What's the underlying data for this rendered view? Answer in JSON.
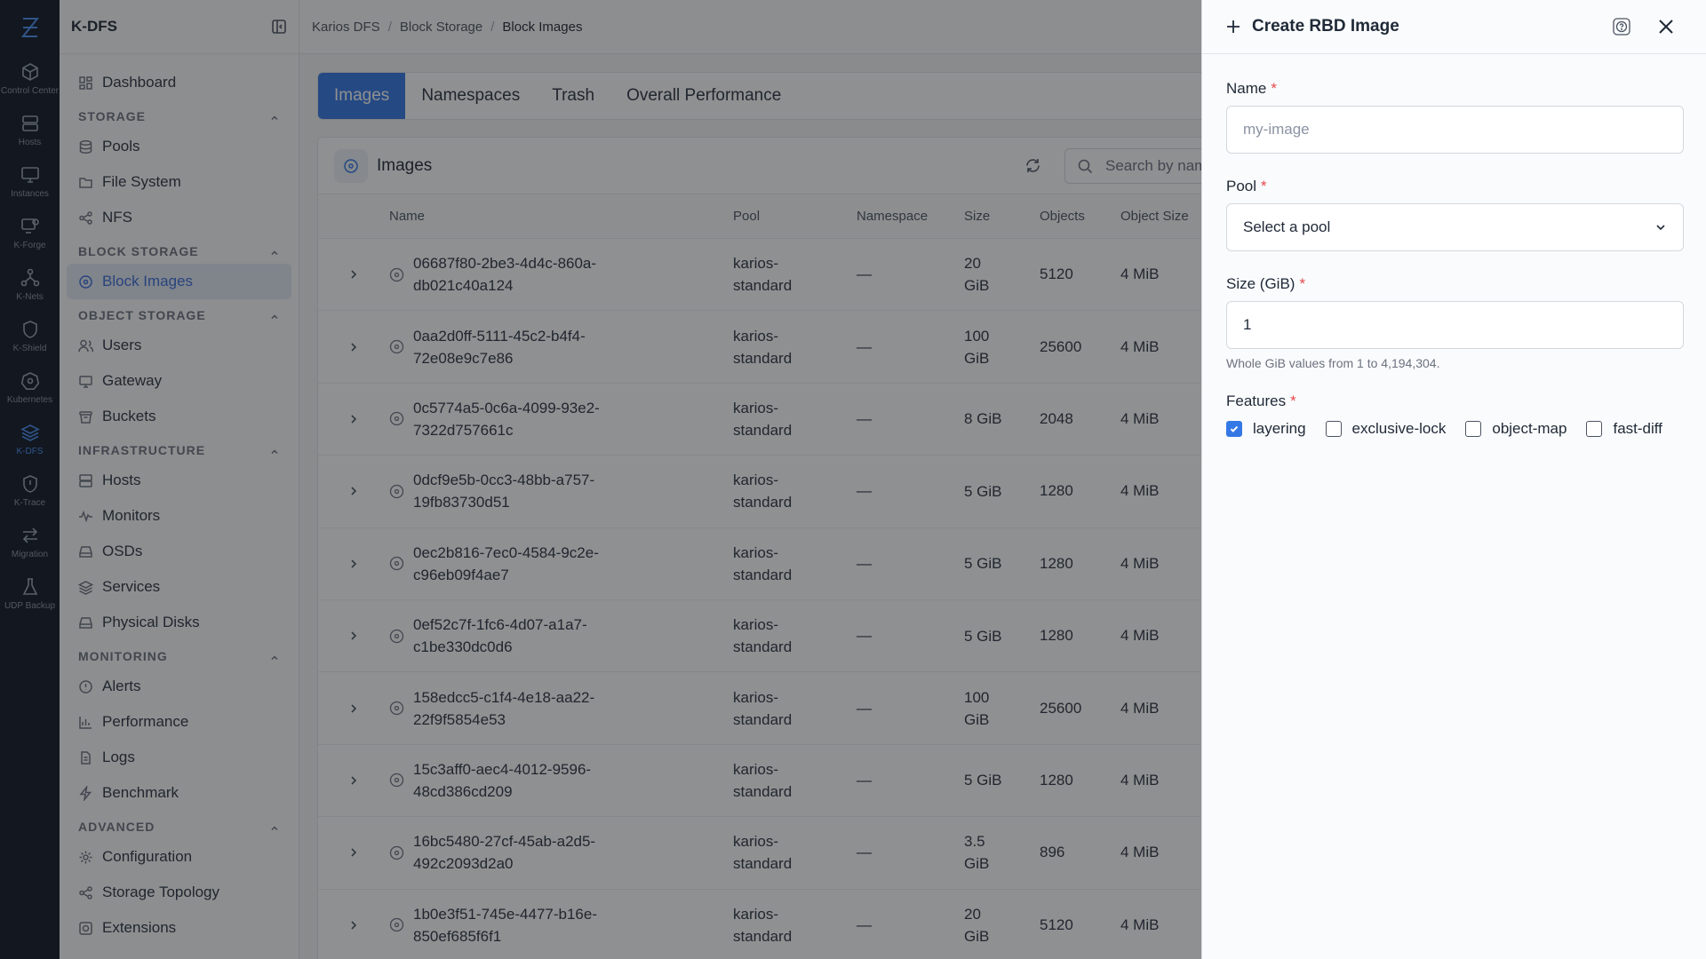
{
  "rail": [
    {
      "label": "Control Center",
      "icon": "cube-icon"
    },
    {
      "label": "Hosts",
      "icon": "server-icon"
    },
    {
      "label": "Instances",
      "icon": "monitor-icon"
    },
    {
      "label": "K-Forge",
      "icon": "forge-icon"
    },
    {
      "label": "K-Nets",
      "icon": "network-icon"
    },
    {
      "label": "K-Shield",
      "icon": "shield-icon"
    },
    {
      "label": "Kubernetes",
      "icon": "kubernetes-icon"
    },
    {
      "label": "K-DFS",
      "icon": "layers-icon"
    },
    {
      "label": "K-Trace",
      "icon": "trace-icon"
    },
    {
      "label": "Migration",
      "icon": "arrows-icon"
    },
    {
      "label": "UDP Backup",
      "icon": "flask-icon"
    }
  ],
  "sidebar": {
    "title": "K-DFS",
    "dashboard": "Dashboard",
    "sections": [
      {
        "title": "STORAGE",
        "items": [
          "Pools",
          "File System",
          "NFS"
        ]
      },
      {
        "title": "BLOCK STORAGE",
        "items": [
          "Block Images"
        ]
      },
      {
        "title": "OBJECT STORAGE",
        "items": [
          "Users",
          "Gateway",
          "Buckets"
        ]
      },
      {
        "title": "INFRASTRUCTURE",
        "items": [
          "Hosts",
          "Monitors",
          "OSDs",
          "Services",
          "Physical Disks"
        ]
      },
      {
        "title": "MONITORING",
        "items": [
          "Alerts",
          "Performance",
          "Logs",
          "Benchmark"
        ]
      },
      {
        "title": "ADVANCED",
        "items": [
          "Configuration",
          "Storage Topology",
          "Extensions"
        ]
      }
    ]
  },
  "breadcrumb": [
    "Karios DFS",
    "Block Storage",
    "Block Images"
  ],
  "tabs": [
    "Images",
    "Namespaces",
    "Trash",
    "Overall Performance"
  ],
  "card": {
    "title": "Images",
    "search_placeholder": "Search by name..."
  },
  "table": {
    "columns": [
      "Name",
      "Pool",
      "Namespace",
      "Size",
      "Objects",
      "Object Size"
    ],
    "rows": [
      {
        "name1": "06687f80-2be3-4d4c-860a-",
        "name2": "db021c40a124",
        "pool1": "karios-",
        "pool2": "standard",
        "ns": "—",
        "size1": "20",
        "size2": "GiB",
        "objects": "5120",
        "objsize": "4 MiB"
      },
      {
        "name1": "0aa2d0ff-5111-45c2-b4f4-",
        "name2": "72e08e9c7e86",
        "pool1": "karios-",
        "pool2": "standard",
        "ns": "—",
        "size1": "100",
        "size2": "GiB",
        "objects": "25600",
        "objsize": "4 MiB"
      },
      {
        "name1": "0c5774a5-0c6a-4099-93e2-",
        "name2": "7322d757661c",
        "pool1": "karios-",
        "pool2": "standard",
        "ns": "—",
        "size1": "8 GiB",
        "size2": "",
        "objects": "2048",
        "objsize": "4 MiB"
      },
      {
        "name1": "0dcf9e5b-0cc3-48bb-a757-",
        "name2": "19fb83730d51",
        "pool1": "karios-",
        "pool2": "standard",
        "ns": "—",
        "size1": "5 GiB",
        "size2": "",
        "objects": "1280",
        "objsize": "4 MiB"
      },
      {
        "name1": "0ec2b816-7ec0-4584-9c2e-",
        "name2": "c96eb09f4ae7",
        "pool1": "karios-",
        "pool2": "standard",
        "ns": "—",
        "size1": "5 GiB",
        "size2": "",
        "objects": "1280",
        "objsize": "4 MiB"
      },
      {
        "name1": "0ef52c7f-1fc6-4d07-a1a7-",
        "name2": "c1be330dc0d6",
        "pool1": "karios-",
        "pool2": "standard",
        "ns": "—",
        "size1": "5 GiB",
        "size2": "",
        "objects": "1280",
        "objsize": "4 MiB"
      },
      {
        "name1": "158edcc5-c1f4-4e18-aa22-",
        "name2": "22f9f5854e53",
        "pool1": "karios-",
        "pool2": "standard",
        "ns": "—",
        "size1": "100",
        "size2": "GiB",
        "objects": "25600",
        "objsize": "4 MiB"
      },
      {
        "name1": "15c3aff0-aec4-4012-9596-",
        "name2": "48cd386cd209",
        "pool1": "karios-",
        "pool2": "standard",
        "ns": "—",
        "size1": "5 GiB",
        "size2": "",
        "objects": "1280",
        "objsize": "4 MiB"
      },
      {
        "name1": "16bc5480-27cf-45ab-a2d5-",
        "name2": "492c2093d2a0",
        "pool1": "karios-",
        "pool2": "standard",
        "ns": "—",
        "size1": "3.5",
        "size2": "GiB",
        "objects": "896",
        "objsize": "4 MiB"
      },
      {
        "name1": "1b0e3f51-745e-4477-b16e-",
        "name2": "850ef685f6f1",
        "pool1": "karios-",
        "pool2": "standard",
        "ns": "—",
        "size1": "20",
        "size2": "GiB",
        "objects": "5120",
        "objsize": "4 MiB"
      }
    ]
  },
  "drawer": {
    "title": "Create RBD Image",
    "name_label": "Name",
    "name_placeholder": "my-image",
    "pool_label": "Pool",
    "pool_placeholder": "Select a pool",
    "size_label": "Size (GiB)",
    "size_value": "1",
    "size_hint": "Whole GiB values from 1 to 4,194,304.",
    "features_label": "Features",
    "features": [
      {
        "label": "layering",
        "checked": true
      },
      {
        "label": "exclusive-lock",
        "checked": false
      },
      {
        "label": "object-map",
        "checked": false
      },
      {
        "label": "fast-diff",
        "checked": false
      }
    ],
    "required_mark": "*"
  },
  "colors": {
    "accent": "#3478e5",
    "rail_bg": "#111827",
    "required": "#e5484d"
  }
}
